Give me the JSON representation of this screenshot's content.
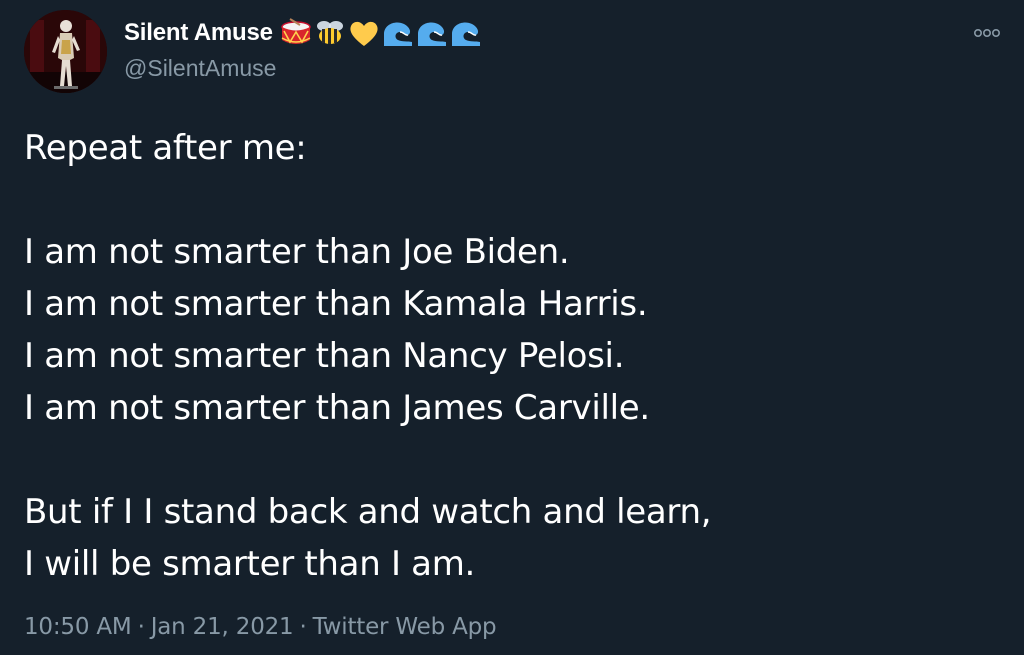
{
  "author": {
    "display_name": "Silent Amuse",
    "handle": "@SilentAmuse",
    "emojis": [
      "drum-icon",
      "bee-icon",
      "yellow-heart-icon",
      "wave-icon",
      "wave-icon",
      "wave-icon"
    ]
  },
  "tweet": {
    "lines": [
      "Repeat after me:",
      "",
      "I am not smarter than Joe Biden.",
      "I am not smarter than Kamala Harris.",
      "I am not smarter than Nancy Pelosi.",
      "I am not smarter than James Carville.",
      "",
      "But if I I stand back and watch and learn,",
      "I will be smarter than I am."
    ]
  },
  "meta": {
    "time": "10:50 AM",
    "date": "Jan 21, 2021",
    "separator": "·",
    "source": "Twitter Web App"
  },
  "colors": {
    "background": "#15202b",
    "text": "#ffffff",
    "secondary": "#8899a6"
  }
}
